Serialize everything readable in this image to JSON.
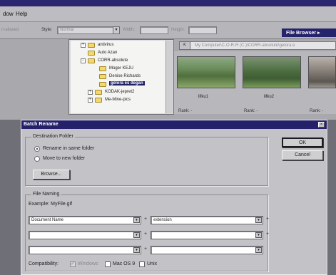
{
  "menubar": {
    "items": [
      "dow",
      "Help"
    ]
  },
  "options": {
    "anti_aliased_label": "n-aliased",
    "style_label": "Style:",
    "style_value": "Normal",
    "width_label": "Width:",
    "height_label": "Height:"
  },
  "file_browser_button": "File Browser ▸",
  "tree": {
    "items": [
      {
        "label": "antivirus",
        "toggle": "+"
      },
      {
        "label": "Auto Azan",
        "toggle": ""
      },
      {
        "label": "CORR-absolute",
        "toggle": "−"
      },
      {
        "label": "Moger KEJU",
        "toggle": ""
      },
      {
        "label": "Denise Richards",
        "toggle": ""
      },
      {
        "label": "gelora es degan",
        "toggle": "",
        "selected": true
      },
      {
        "label": "KODAK-jepret2",
        "toggle": "+"
      },
      {
        "label": "Me-Mine-pics",
        "toggle": "+"
      }
    ]
  },
  "address": "My Computer\\C-O-R-R (C:)\\CORR-absolute\\gelora e",
  "thumbnails": [
    {
      "name": "lifku1",
      "rank": "Rank: -"
    },
    {
      "name": "lifku2",
      "rank": "Rank: -"
    },
    {
      "name": "",
      "rank": "Rank: -"
    }
  ],
  "dialog": {
    "title": "Batch Rename",
    "close": "×",
    "destination": {
      "legend": "Destination Folder",
      "rename_same": "Rename in same folder",
      "move_new": "Move to new folder",
      "browse": "Browse..."
    },
    "ok": "OK",
    "cancel": "Cancel",
    "naming": {
      "legend": "File Naming",
      "example": "Example: MyFile.gif",
      "row1_left": "Document Name",
      "row1_right": "extension",
      "plus": "+"
    },
    "compatibility": {
      "label": "Compatibility:",
      "windows": "Windows",
      "mac": "Mac OS 9",
      "unix": "Unix"
    }
  }
}
